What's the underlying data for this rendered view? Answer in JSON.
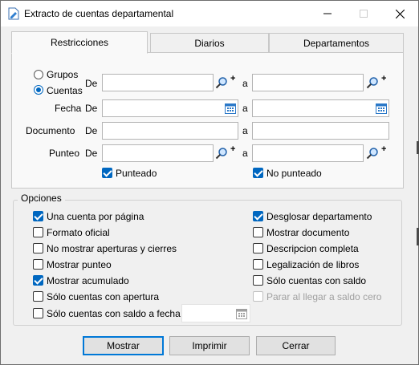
{
  "window": {
    "title": "Extracto de cuentas departamental"
  },
  "tabs": [
    {
      "label": "Restricciones",
      "active": true
    },
    {
      "label": "Diarios",
      "active": false
    },
    {
      "label": "Departamentos",
      "active": false
    }
  ],
  "restricciones": {
    "radio_grupos": "Grupos",
    "radio_cuentas": "Cuentas",
    "selected_radio": "Cuentas",
    "de_label": "De",
    "a_label": "a",
    "fecha_label": "Fecha",
    "documento_label": "Documento",
    "punteo_label": "Punteo",
    "cuentas_de": "",
    "cuentas_a": "",
    "fecha_de": "",
    "fecha_a": "",
    "documento_de": "",
    "documento_a": "",
    "punteo_de": "",
    "punteo_a": "",
    "punteado": {
      "label": "Punteado",
      "checked": true
    },
    "no_punteado": {
      "label": "No punteado",
      "checked": true
    }
  },
  "opciones": {
    "title": "Opciones",
    "left": [
      {
        "label": "Una cuenta por página",
        "checked": true
      },
      {
        "label": "Formato oficial",
        "checked": false
      },
      {
        "label": "No mostrar aperturas y cierres",
        "checked": false
      },
      {
        "label": "Mostrar punteo",
        "checked": false
      },
      {
        "label": "Mostrar acumulado",
        "checked": true
      },
      {
        "label": "Sólo cuentas con apertura",
        "checked": false
      },
      {
        "label": "Sólo cuentas con saldo a fecha",
        "checked": false
      }
    ],
    "right": [
      {
        "label": "Desglosar departamento",
        "checked": true
      },
      {
        "label": "Mostrar documento",
        "checked": false
      },
      {
        "label": "Descripcion completa",
        "checked": false
      },
      {
        "label": "Legalización de libros",
        "checked": false
      },
      {
        "label": "Sólo cuentas con saldo",
        "checked": false
      },
      {
        "label": "Parar al llegar a saldo cero",
        "checked": false,
        "disabled": true
      }
    ],
    "saldo_fecha_value": ""
  },
  "buttons": {
    "mostrar": "Mostrar",
    "imprimir": "Imprimir",
    "cerrar": "Cerrar"
  },
  "icons": {
    "search": "magnifier-icon",
    "add": "plus-icon",
    "calendar": "calendar-icon"
  },
  "colors": {
    "accent": "#0067c0",
    "window_bg": "#f0f0f0",
    "panel_bg": "#f9f9f9",
    "default_button_border": "#0078d7"
  }
}
